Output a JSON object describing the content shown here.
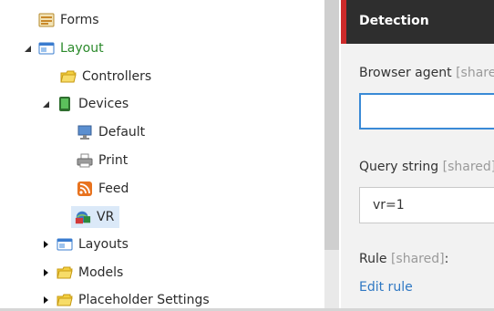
{
  "tree": {
    "items": [
      {
        "label": "Forms",
        "icon": "forms-icon"
      },
      {
        "label": "Layout",
        "icon": "layout-icon"
      },
      {
        "label": "Controllers",
        "icon": "folder-icon"
      },
      {
        "label": "Devices",
        "icon": "devices-icon"
      },
      {
        "label": "Default",
        "icon": "monitor-icon"
      },
      {
        "label": "Print",
        "icon": "printer-icon"
      },
      {
        "label": "Feed",
        "icon": "rss-icon"
      },
      {
        "label": "VR",
        "icon": "vr-icon"
      },
      {
        "label": "Layouts",
        "icon": "layouts-icon"
      },
      {
        "label": "Models",
        "icon": "folder-icon"
      },
      {
        "label": "Placeholder Settings",
        "icon": "folder-icon"
      }
    ]
  },
  "detail": {
    "section_title": "Detection",
    "browser_agent": {
      "label": "Browser agent",
      "shared": "[shared]",
      "value": ""
    },
    "query_string": {
      "label": "Query string",
      "shared": "[shared]",
      "value": "vr=1"
    },
    "rule": {
      "label": "Rule",
      "shared": "[shared]",
      "suffix": ":"
    },
    "edit_rule": "Edit rule"
  },
  "colors": {
    "header_bg": "#2e2e2e",
    "header_accent": "#cc2a2a",
    "link": "#2f78c3",
    "selected_bg": "#dbe9f8",
    "active_border": "#3a8ad6"
  }
}
